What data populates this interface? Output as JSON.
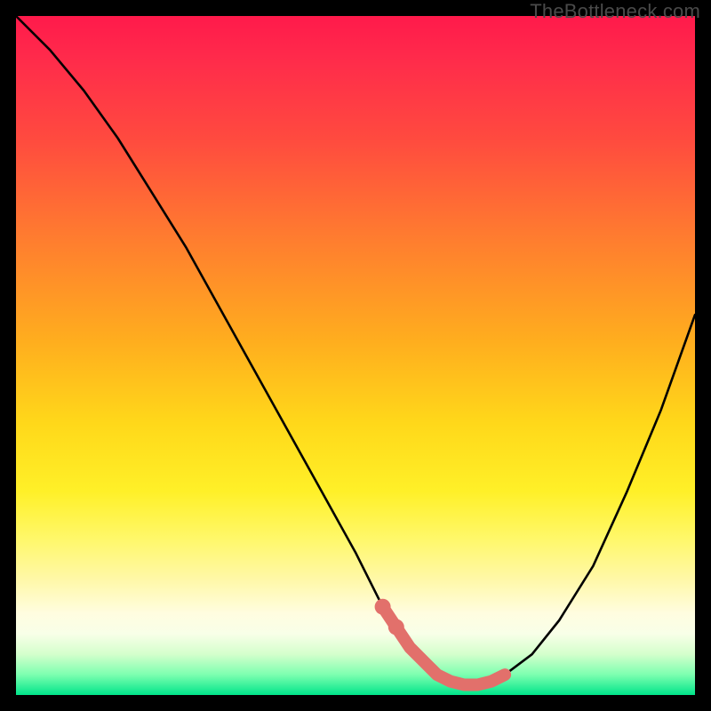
{
  "watermark": "TheBottleneck.com",
  "colors": {
    "background": "#000000",
    "line_main": "#000000",
    "line_highlight": "#e2706b"
  },
  "chart_data": {
    "type": "line",
    "title": "",
    "xlabel": "",
    "ylabel": "",
    "xlim": [
      0,
      100
    ],
    "ylim": [
      0,
      100
    ],
    "series": [
      {
        "name": "bottleneck-curve",
        "x": [
          0,
          5,
          10,
          15,
          20,
          25,
          30,
          35,
          40,
          45,
          50,
          54,
          56,
          58,
          60,
          62,
          64,
          66,
          68,
          70,
          72,
          76,
          80,
          85,
          90,
          95,
          100
        ],
        "y": [
          100,
          95,
          89,
          82,
          74,
          66,
          57,
          48,
          39,
          30,
          21,
          13,
          10,
          7,
          5,
          3,
          2,
          1.5,
          1.5,
          2,
          3,
          6,
          11,
          19,
          30,
          42,
          56
        ]
      }
    ],
    "highlight": {
      "name": "optimal-zone",
      "x": [
        54,
        56,
        58,
        60,
        62,
        64,
        66,
        68,
        70,
        72
      ],
      "y": [
        13,
        10,
        7,
        5,
        3,
        2,
        1.5,
        1.5,
        2,
        3
      ]
    }
  }
}
